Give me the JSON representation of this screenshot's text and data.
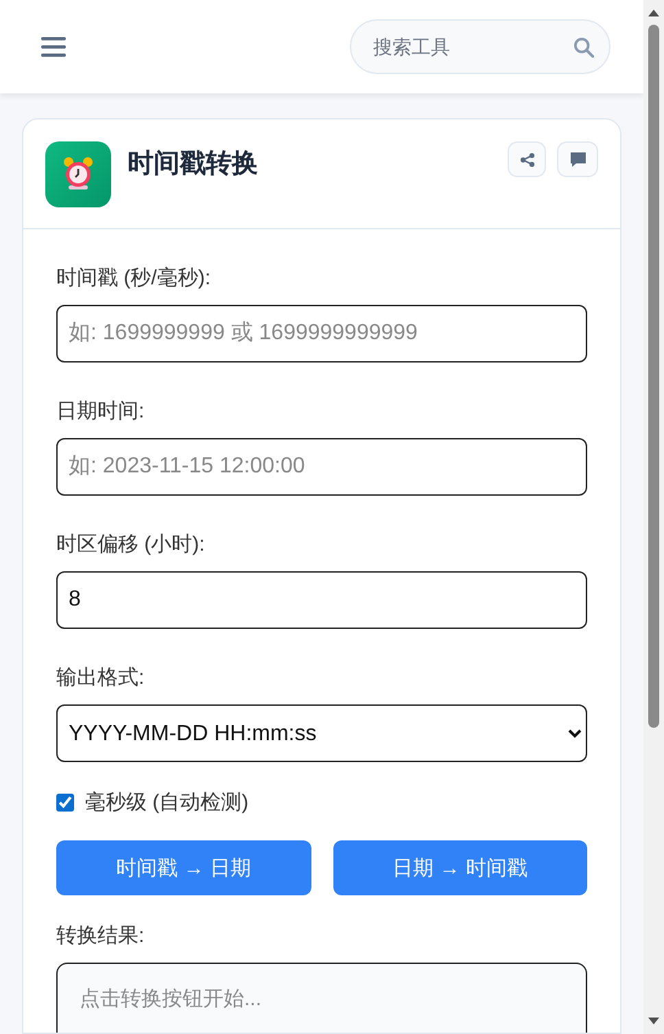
{
  "header": {
    "search": {
      "placeholder": "搜索工具"
    }
  },
  "tool": {
    "title": "时间戳转换"
  },
  "fields": [
    {
      "kind": "input",
      "label": "时间戳 (秒/毫秒):",
      "placeholder": "如: 1699999999 或 1699999999999"
    },
    {
      "kind": "input",
      "label": "日期时间:",
      "placeholder": "如: 2023-11-15 12:00:00"
    },
    {
      "kind": "input",
      "label": "时区偏移 (小时):",
      "value": "8"
    },
    {
      "kind": "select",
      "label": "输出格式:",
      "value": "YYYY-MM-DD HH:mm:ss"
    }
  ],
  "option": {
    "label": "毫秒级 (自动检测)",
    "checked": true
  },
  "buttons": [
    "时间戳 → 日期",
    "日期 → 时间戳"
  ],
  "result": {
    "label": "转换结果:",
    "placeholder": "点击转换按钮开始..."
  }
}
